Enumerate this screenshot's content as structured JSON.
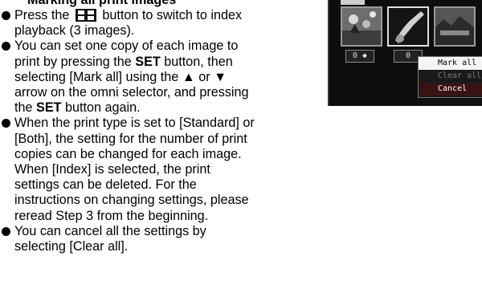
{
  "heading": "Marking all print images",
  "bullets": [
    {
      "lines": [
        [
          "Press the ",
          {
            "icon": "index-playback-icon"
          },
          " button to switch to index"
        ],
        [
          "playback (3 images)."
        ]
      ]
    },
    {
      "lines": [
        [
          "You can set one copy of each image to"
        ],
        [
          "print by pressing the ",
          {
            "b": "SET"
          },
          " button, then"
        ],
        [
          "selecting [Mark all] using the ▲ or ▼"
        ],
        [
          "arrow on the omni selector, and pressing"
        ],
        [
          "the ",
          {
            "b": "SET"
          },
          " button again."
        ]
      ]
    },
    {
      "lines": [
        [
          "When the print type is set to [Standard] or"
        ],
        [
          "[Both], the setting for the number of print"
        ],
        [
          "copies can be changed for each image."
        ],
        [
          "When [Index] is selected, the print"
        ],
        [
          "settings can be deleted. For the"
        ],
        [
          "instructions on changing settings, please"
        ],
        [
          "reread Step 3 from the beginning."
        ]
      ]
    },
    {
      "lines": [
        [
          "You can cancel all the settings by"
        ],
        [
          "selecting [Clear all]."
        ]
      ]
    }
  ],
  "camera_screen": {
    "copy_counts": [
      "0",
      "0"
    ],
    "menu": {
      "items": [
        {
          "label": "Mark all",
          "state": "active"
        },
        {
          "label": "Clear all",
          "state": "disabled"
        },
        {
          "label": "Cancel",
          "state": "normal"
        }
      ]
    }
  }
}
